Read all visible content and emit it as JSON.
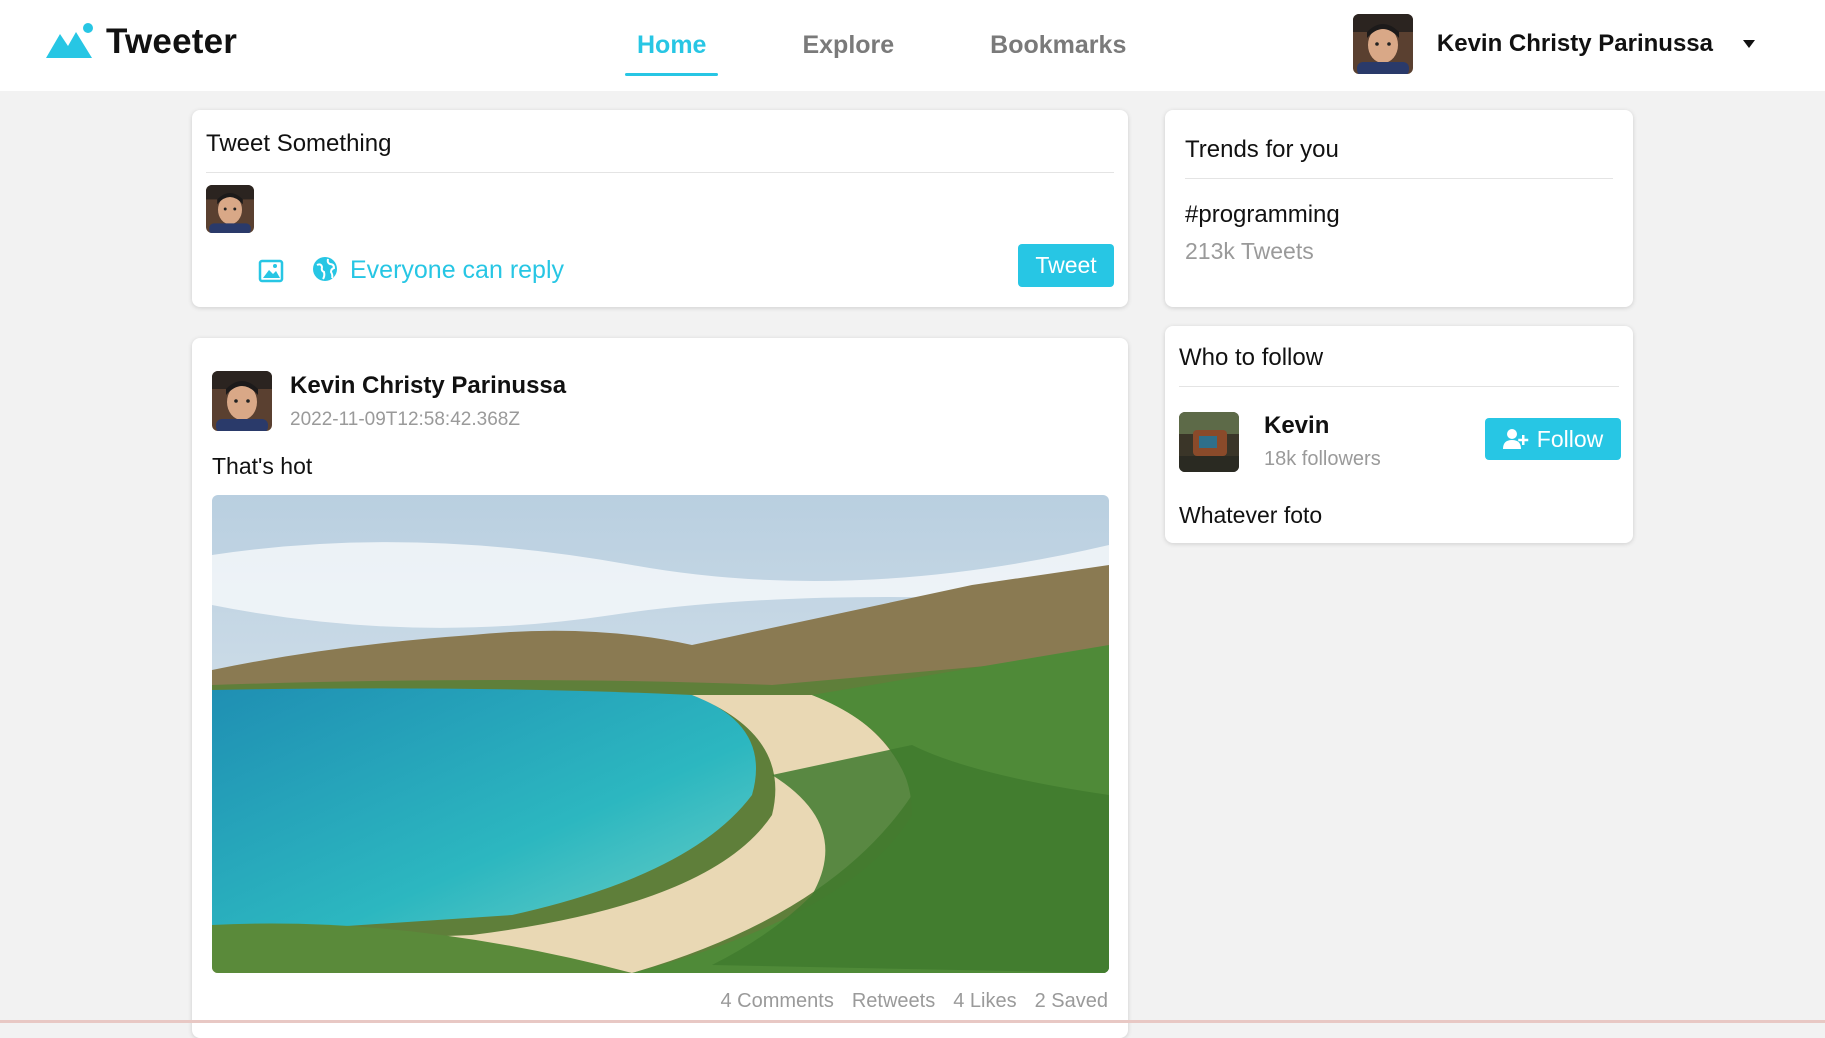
{
  "app": {
    "name": "Tweeter",
    "accent": "#27c6e4"
  },
  "nav": {
    "items": [
      {
        "label": "Home",
        "active": true
      },
      {
        "label": "Explore",
        "active": false
      },
      {
        "label": "Bookmarks",
        "active": false
      }
    ]
  },
  "user": {
    "name": "Kevin Christy Parinussa",
    "avatar_icon": "user-avatar"
  },
  "compose": {
    "title": "Tweet Something",
    "placeholder": "",
    "reply_setting": "Everyone can reply",
    "submit_label": "Tweet",
    "icons": [
      "image-icon",
      "globe-icon"
    ]
  },
  "post": {
    "author": "Kevin Christy Parinussa",
    "timestamp": "2022-11-09T12:58:42.368Z",
    "text": "That's hot",
    "image": "beach-bay-photo",
    "stats": {
      "comments": "4 Comments",
      "retweets": "Retweets",
      "likes": "4 Likes",
      "saved": "2 Saved"
    }
  },
  "trends": {
    "title": "Trends for you",
    "items": [
      {
        "tag": "#programming",
        "count": "213k Tweets"
      }
    ]
  },
  "who_to_follow": {
    "title": "Who to follow",
    "suggestions": [
      {
        "name": "Kevin",
        "followers": "18k followers",
        "bio": "Whatever foto",
        "button_label": "Follow"
      }
    ]
  }
}
